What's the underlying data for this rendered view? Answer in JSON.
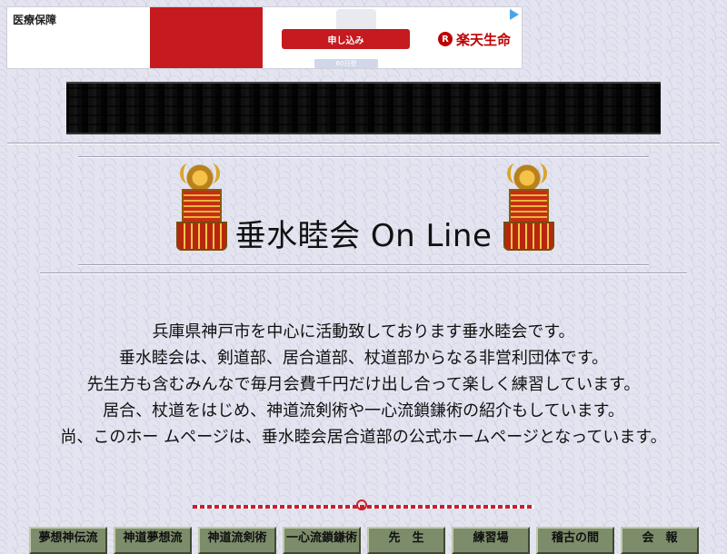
{
  "ad": {
    "title": "医療保障",
    "cta_label": "申し込み",
    "sub_label": "60日型",
    "brand_mark": "R",
    "brand_name": "楽天生命"
  },
  "title": "垂水睦会 On Line",
  "intro": [
    "兵庫県神戸市を中心に活動致しております垂水睦会です。",
    "垂水睦会は、剣道部、居合道部、杖道部からなる非営利団体です。",
    "先生方も含むみんなで毎月会費千円だけ出し合って楽しく練習しています。",
    "居合、杖道をはじめ、神道流剣術や一心流鎖鎌術の紹介もしています。",
    "尚、このホー ムページは、垂水睦会居合道部の公式ホームページとなっています。"
  ],
  "nav": [
    {
      "label": "夢想神伝流"
    },
    {
      "label": "神道夢想流"
    },
    {
      "label": "神道流剣術"
    },
    {
      "label": "一心流鎖鎌術"
    },
    {
      "label": "先　生"
    },
    {
      "label": "練習場"
    },
    {
      "label": "稽古の間"
    },
    {
      "label": "会　報"
    }
  ],
  "colors": {
    "ad_red": "#c51a1f",
    "brand_red": "#bf0000",
    "nav_bg": "#7d8d6b",
    "page_bg": "#e4e4f0"
  },
  "icons": [
    "adchoices-icon",
    "samurai-armor-icon",
    "samurai-armor-icon"
  ]
}
